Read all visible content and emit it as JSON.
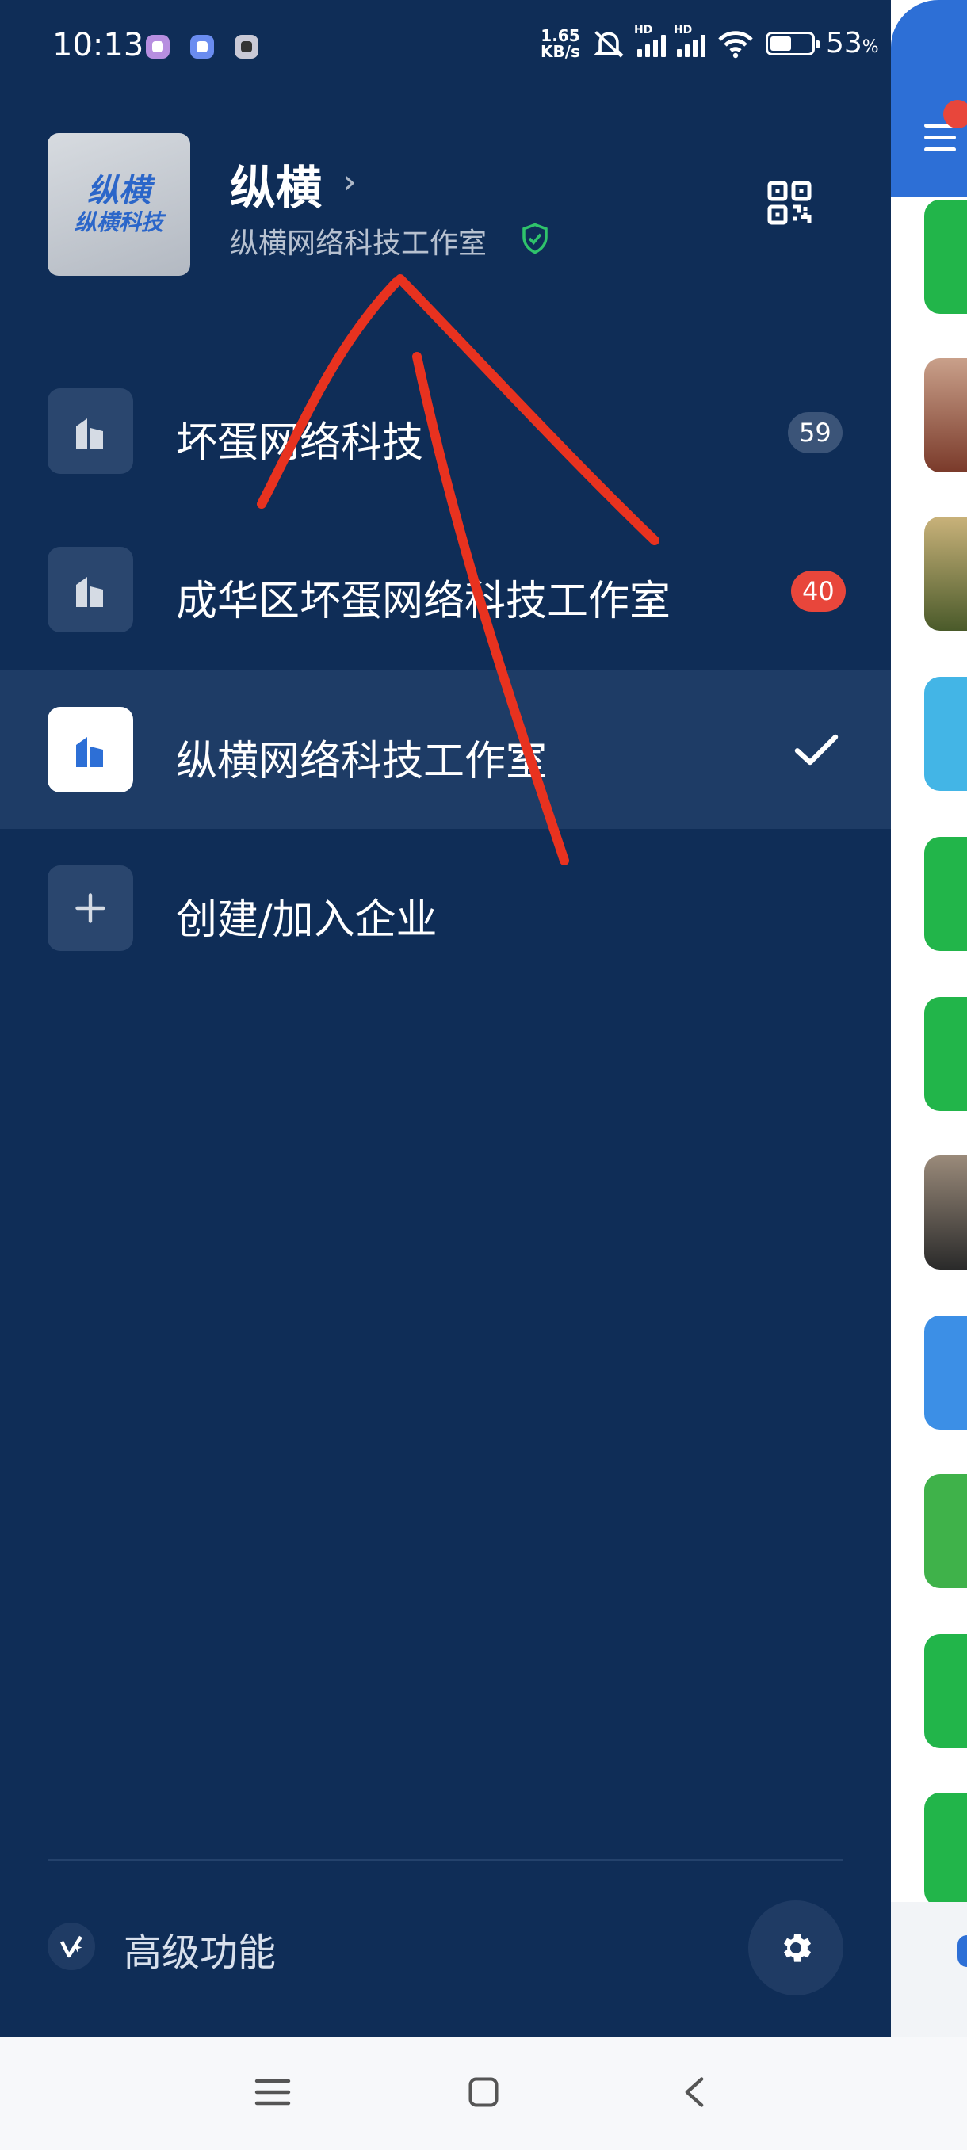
{
  "status_bar": {
    "time": "10:13",
    "speed_value": "1.65",
    "speed_unit": "KB/s",
    "signal_tag_1": "HD",
    "signal_tag_2": "HD",
    "battery_percent": "53",
    "battery_unit": "%",
    "battery_level": 0.53,
    "app_icon_colors": [
      "#b78ee0",
      "#6a8cf0",
      "#c9c9d6"
    ]
  },
  "profile": {
    "name": "纵横",
    "organization": "纵横网络科技工作室",
    "avatar_logo_top": "纵横",
    "avatar_logo_bottom": "纵横科技",
    "icons": {
      "chevron": "chevron-right-icon",
      "verified": "shield-check-icon",
      "qr": "qr-code-icon"
    }
  },
  "org_list": [
    {
      "label": "坏蛋网络科技",
      "badge": "59",
      "badge_style": "gray",
      "active": false
    },
    {
      "label": "成华区坏蛋网络科技工作室",
      "badge": "40",
      "badge_style": "red",
      "active": false
    },
    {
      "label": "纵横网络科技工作室",
      "badge": "",
      "active": true
    },
    {
      "label": "创建/加入企业",
      "badge": "",
      "active": false,
      "icon": "plus-icon"
    }
  ],
  "footer": {
    "advanced_label": "高级功能",
    "icons": {
      "advanced": "sparkle-icon",
      "settings": "gear-icon"
    }
  },
  "colors": {
    "drawer_bg": "#0f2d57",
    "active_row": "#1e3c66",
    "badge_gray": "#3b5478",
    "badge_red": "#e8463b",
    "verified_green": "#2fc36b",
    "annotation_red": "#e8321f",
    "brand_blue": "#2d6fd6"
  },
  "nav_bar": {
    "icons": [
      "menu-icon",
      "home-square-icon",
      "back-icon"
    ]
  }
}
